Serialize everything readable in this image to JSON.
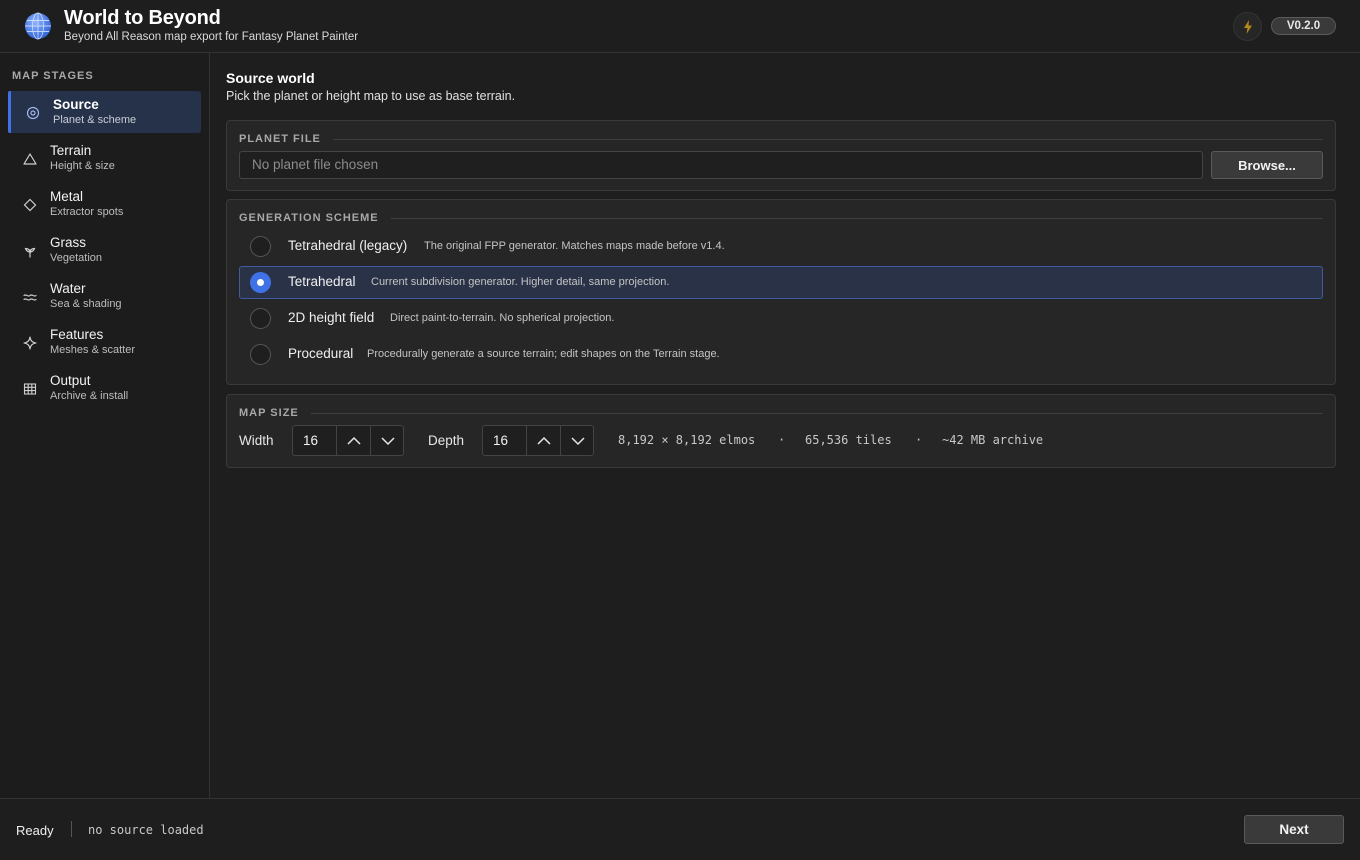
{
  "app": {
    "title": "World to Beyond",
    "subtitle": "Beyond All Reason map export for Fantasy Planet Painter",
    "version": "V0.2.0",
    "logo_icon": "globe-icon",
    "quick_icon": "lightning-bolt-icon"
  },
  "colors": {
    "accent": "#3f72e6",
    "background": "#1e1e1e",
    "panel": "#262626",
    "selected_row": "#2a3247",
    "bolt": "#b58a1a"
  },
  "sidebar": {
    "heading": "MAP STAGES",
    "items": [
      {
        "label": "Source",
        "sub": "Planet & scheme",
        "icon": "target-icon",
        "active": true
      },
      {
        "label": "Terrain",
        "sub": "Height & size",
        "icon": "triangle-icon",
        "active": false
      },
      {
        "label": "Metal",
        "sub": "Extractor spots",
        "icon": "diamond-icon",
        "active": false
      },
      {
        "label": "Grass",
        "sub": "Vegetation",
        "icon": "sprout-icon",
        "active": false
      },
      {
        "label": "Water",
        "sub": "Sea & shading",
        "icon": "waves-icon",
        "active": false
      },
      {
        "label": "Features",
        "sub": "Meshes & scatter",
        "icon": "sparkle-icon",
        "active": false
      },
      {
        "label": "Output",
        "sub": "Archive & install",
        "icon": "grid-icon",
        "active": false
      }
    ]
  },
  "main": {
    "title": "Source world",
    "subtitle": "Pick the planet or height map to use as base terrain.",
    "planet_file": {
      "legend": "PLANET FILE",
      "placeholder": "No planet file chosen",
      "browse_label": "Browse..."
    },
    "scheme": {
      "legend": "GENERATION SCHEME",
      "selected": "Tetrahedral",
      "options": [
        {
          "label": "Tetrahedral (legacy)",
          "desc": "The original FPP generator. Matches maps made before v1.4."
        },
        {
          "label": "Tetrahedral",
          "desc": "Current subdivision generator. Higher detail, same projection."
        },
        {
          "label": "2D height field",
          "desc": "Direct paint-to-terrain. No spherical projection."
        },
        {
          "label": "Procedural",
          "desc": "Procedurally generate a source terrain; edit shapes on the Terrain stage."
        }
      ]
    },
    "map_size": {
      "legend": "MAP SIZE",
      "width_label": "Width",
      "width_value": "16",
      "depth_label": "Depth",
      "depth_value": "16",
      "elmos": "8,192 × 8,192 elmos",
      "tiles": "65,536 tiles",
      "archive": "~42 MB archive",
      "separator": "·"
    }
  },
  "footer": {
    "status": "Ready",
    "detail": "no source loaded",
    "next_label": "Next"
  }
}
